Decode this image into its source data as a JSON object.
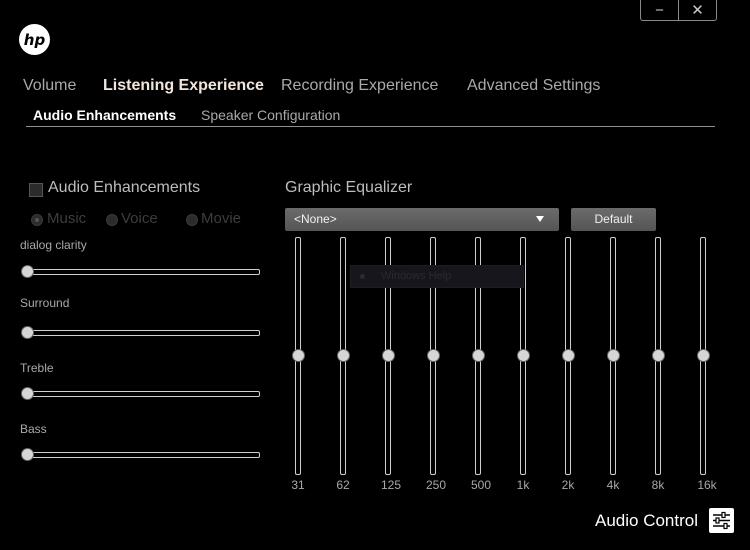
{
  "window": {
    "minimize_label": "−",
    "close_label": "✕"
  },
  "tabs": [
    {
      "label": "Volume",
      "active": false
    },
    {
      "label": "Listening Experience",
      "active": true
    },
    {
      "label": "Recording Experience",
      "active": false
    },
    {
      "label": "Advanced Settings",
      "active": false
    }
  ],
  "subtabs": [
    {
      "label": "Audio Enhancements",
      "active": true
    },
    {
      "label": "Speaker Configuration",
      "active": false
    }
  ],
  "enhancements": {
    "checkbox_label": "Audio Enhancements",
    "checked": false,
    "modes": [
      "Music",
      "Voice",
      "Movie"
    ],
    "selected_mode": "Music",
    "sliders": [
      {
        "label": "dialog clarity",
        "value": 0
      },
      {
        "label": "Surround",
        "value": 0
      },
      {
        "label": "Treble",
        "value": 0
      },
      {
        "label": "Bass",
        "value": 0
      }
    ]
  },
  "equalizer": {
    "title": "Graphic Equalizer",
    "preset": "<None>",
    "default_label": "Default",
    "tooltip": "Windows Help",
    "bands": [
      {
        "freq": "31",
        "level": 0.5
      },
      {
        "freq": "62",
        "level": 0.5
      },
      {
        "freq": "125",
        "level": 0.5
      },
      {
        "freq": "250",
        "level": 0.5
      },
      {
        "freq": "500",
        "level": 0.5
      },
      {
        "freq": "1k",
        "level": 0.5
      },
      {
        "freq": "2k",
        "level": 0.5
      },
      {
        "freq": "4k",
        "level": 0.5
      },
      {
        "freq": "8k",
        "level": 0.5
      },
      {
        "freq": "16k",
        "level": 0.5
      }
    ]
  },
  "footer": {
    "label": "Audio Control",
    "icon": "sliders-icon"
  },
  "logo": {
    "text": "hp"
  },
  "colors": {
    "background": "#000000",
    "active_tab": "#f0e6dc",
    "text": "#a9a9a9",
    "button": "#606060"
  }
}
